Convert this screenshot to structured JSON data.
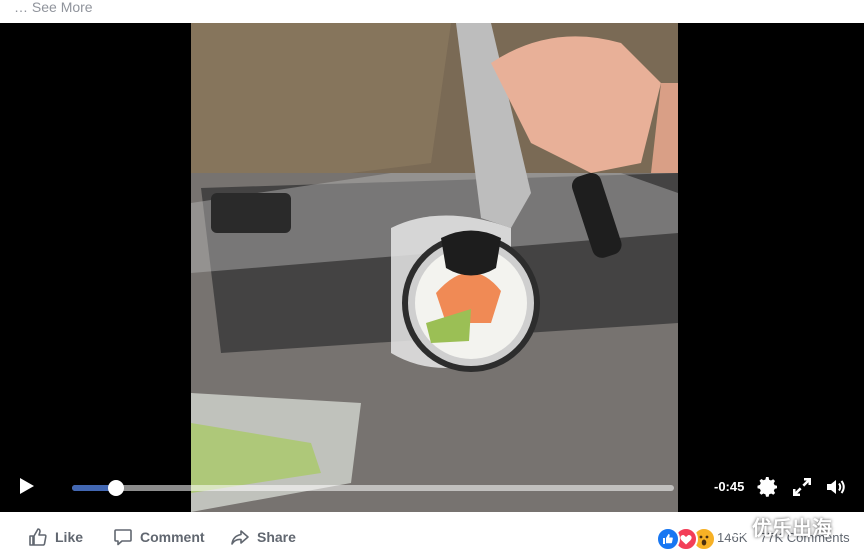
{
  "post": {
    "see_more": "… See More"
  },
  "player": {
    "time_remaining": "-0:45",
    "progress": 0.073,
    "accent": "#4267b2"
  },
  "actions": {
    "like": "Like",
    "comment": "Comment",
    "share": "Share"
  },
  "stats": {
    "reaction_count": "146K",
    "comments": "77K Comments"
  },
  "watermark": {
    "text": "优乐出海"
  },
  "icons": [
    "play-icon",
    "settings-icon",
    "fullscreen-icon",
    "volume-icon",
    "like-icon",
    "comment-icon",
    "share-icon",
    "like-reaction-icon",
    "love-reaction-icon",
    "wow-reaction-icon",
    "wechat-logo-icon"
  ]
}
